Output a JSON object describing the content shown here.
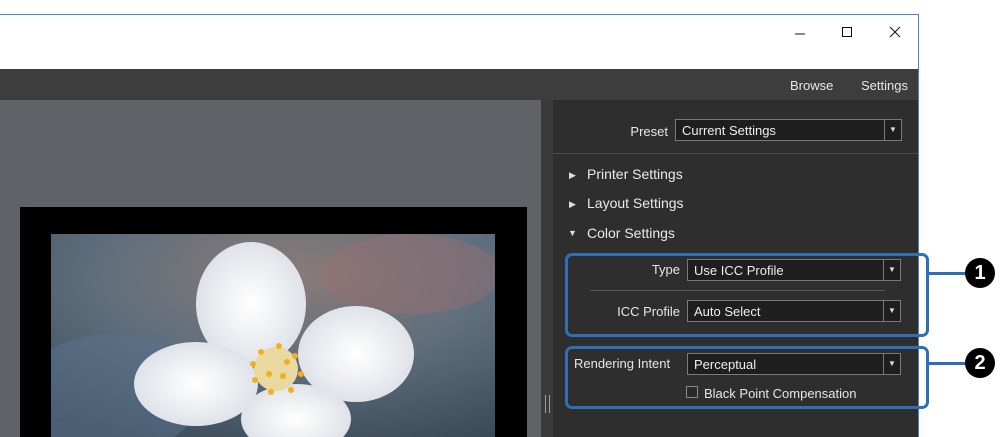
{
  "window": {
    "minimize_icon": "minimize-icon",
    "maximize_icon": "maximize-icon",
    "close_icon": "close-icon"
  },
  "menu": {
    "browse": "Browse",
    "settings": "Settings"
  },
  "panel": {
    "preset_label": "Preset",
    "preset_value": "Current Settings",
    "sections": {
      "printer": "Printer Settings",
      "layout": "Layout Settings",
      "color": "Color Settings"
    },
    "type_label": "Type",
    "type_value": "Use ICC Profile",
    "icc_label": "ICC Profile",
    "icc_value": "Auto Select",
    "intent_label": "Rendering Intent",
    "intent_value": "Perceptual",
    "bpc_label": "Black Point Compensation",
    "bpc_checked": false
  },
  "callouts": {
    "one": "1",
    "two": "2"
  },
  "colors": {
    "highlight": "#2f6fb4",
    "panel_bg": "#2e2e2e",
    "menubar_bg": "#3d3d3d"
  }
}
